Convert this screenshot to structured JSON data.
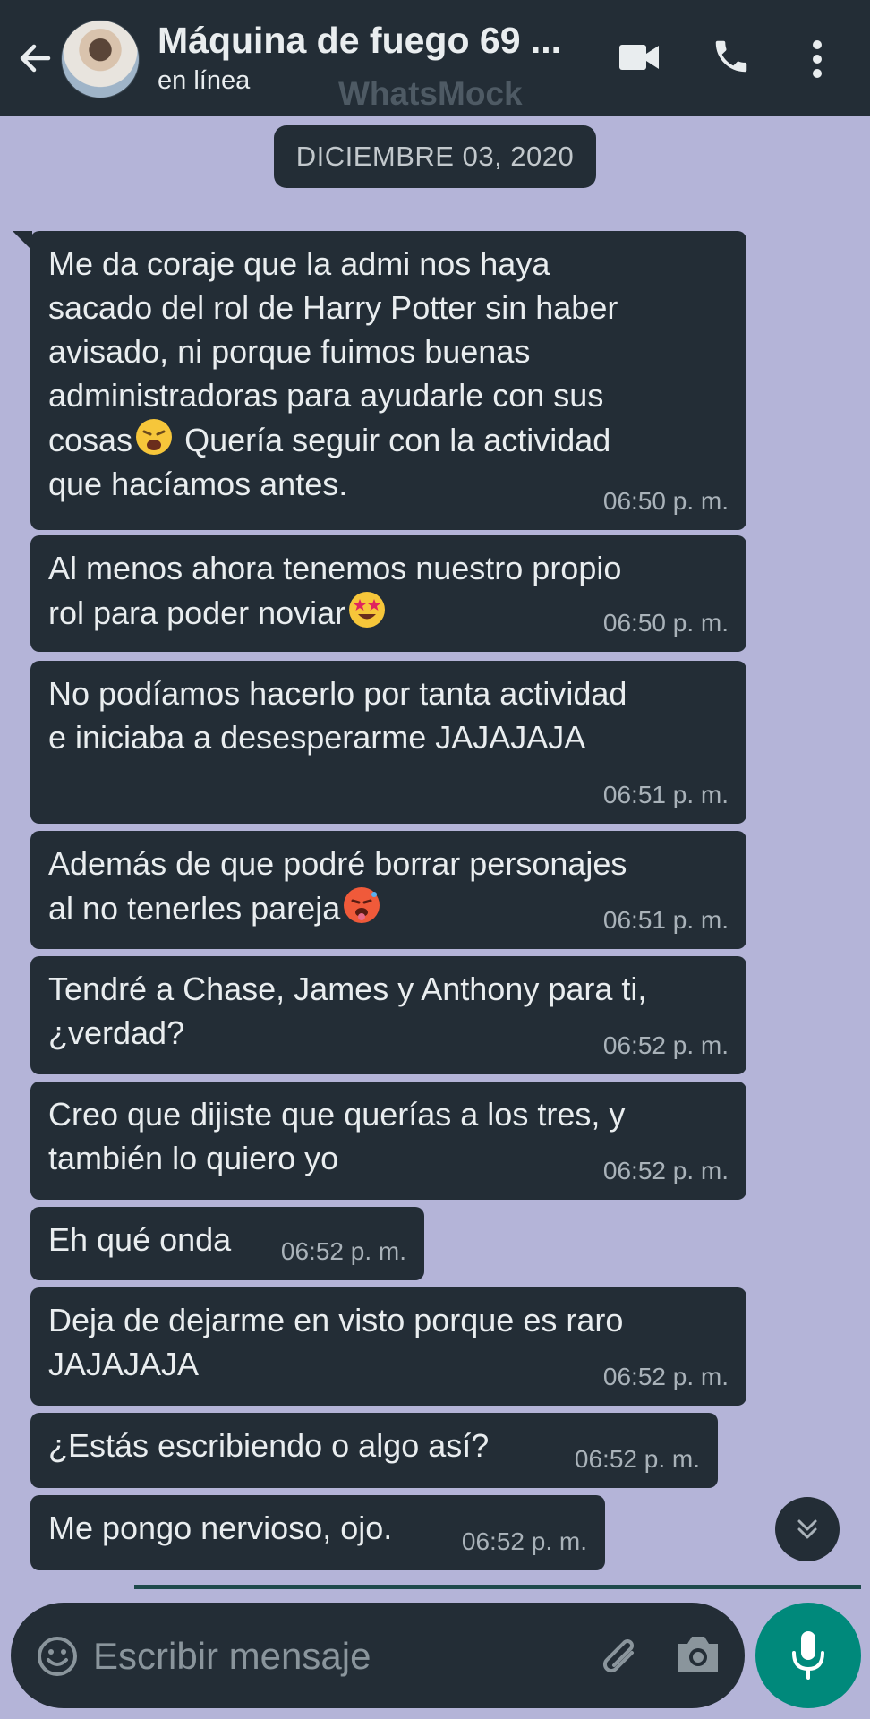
{
  "header": {
    "title": "Máquina de fuego 69 ...",
    "status": "en línea",
    "watermark": "WhatsMock"
  },
  "date_label": "DICIEMBRE 03, 2020",
  "messages": [
    {
      "text": "Me da coraje que la admi nos haya\nsacado del rol de Harry Potter sin haber\navisado, ni porque fuimos buenas\nadministradoras para ayudarle con sus\ncosas",
      "emoji": "weary-face",
      "text_after": "Quería seguir con la actividad\nque hacíamos antes.",
      "time": "06:50 p. m."
    },
    {
      "text": "Al menos ahora tenemos nuestro propio\nrol para poder noviar",
      "emoji": "star-struck",
      "time": "06:50 p. m."
    },
    {
      "text": "No podíamos hacerlo por tanta actividad\ne iniciaba a desesperarme JAJAJAJA",
      "time": "06:51 p. m."
    },
    {
      "text": "Además de que podré borrar personajes\nal no tenerles pareja",
      "emoji": "hot-face",
      "time": "06:51 p. m."
    },
    {
      "text": "Tendré a Chase, James y Anthony para ti,\n¿verdad?",
      "time": "06:52 p. m."
    },
    {
      "text": "Creo que dijiste que querías a los tres, y\ntambién lo quiero yo",
      "time": "06:52 p. m."
    },
    {
      "text": "Eh qué onda",
      "time": "06:52 p. m."
    },
    {
      "text": "Deja de dejarme en visto porque es raro\nJAJAJAJA",
      "time": "06:52 p. m."
    },
    {
      "text": "¿Estás escribiendo o algo así?",
      "time": "06:52 p. m."
    },
    {
      "text": "Me pongo nervioso, ojo.",
      "time": "06:52 p. m."
    }
  ],
  "input": {
    "placeholder": "Escribir mensaje"
  },
  "colors": {
    "header_bg": "#232d36",
    "chat_bg": "#b4b4d8",
    "bubble_bg": "#232d36",
    "accent": "#00897b"
  },
  "icons": [
    "back-arrow-icon",
    "video-call-icon",
    "phone-icon",
    "more-vert-icon",
    "emoji-icon",
    "attach-icon",
    "camera-icon",
    "mic-icon",
    "scroll-down-icon"
  ]
}
